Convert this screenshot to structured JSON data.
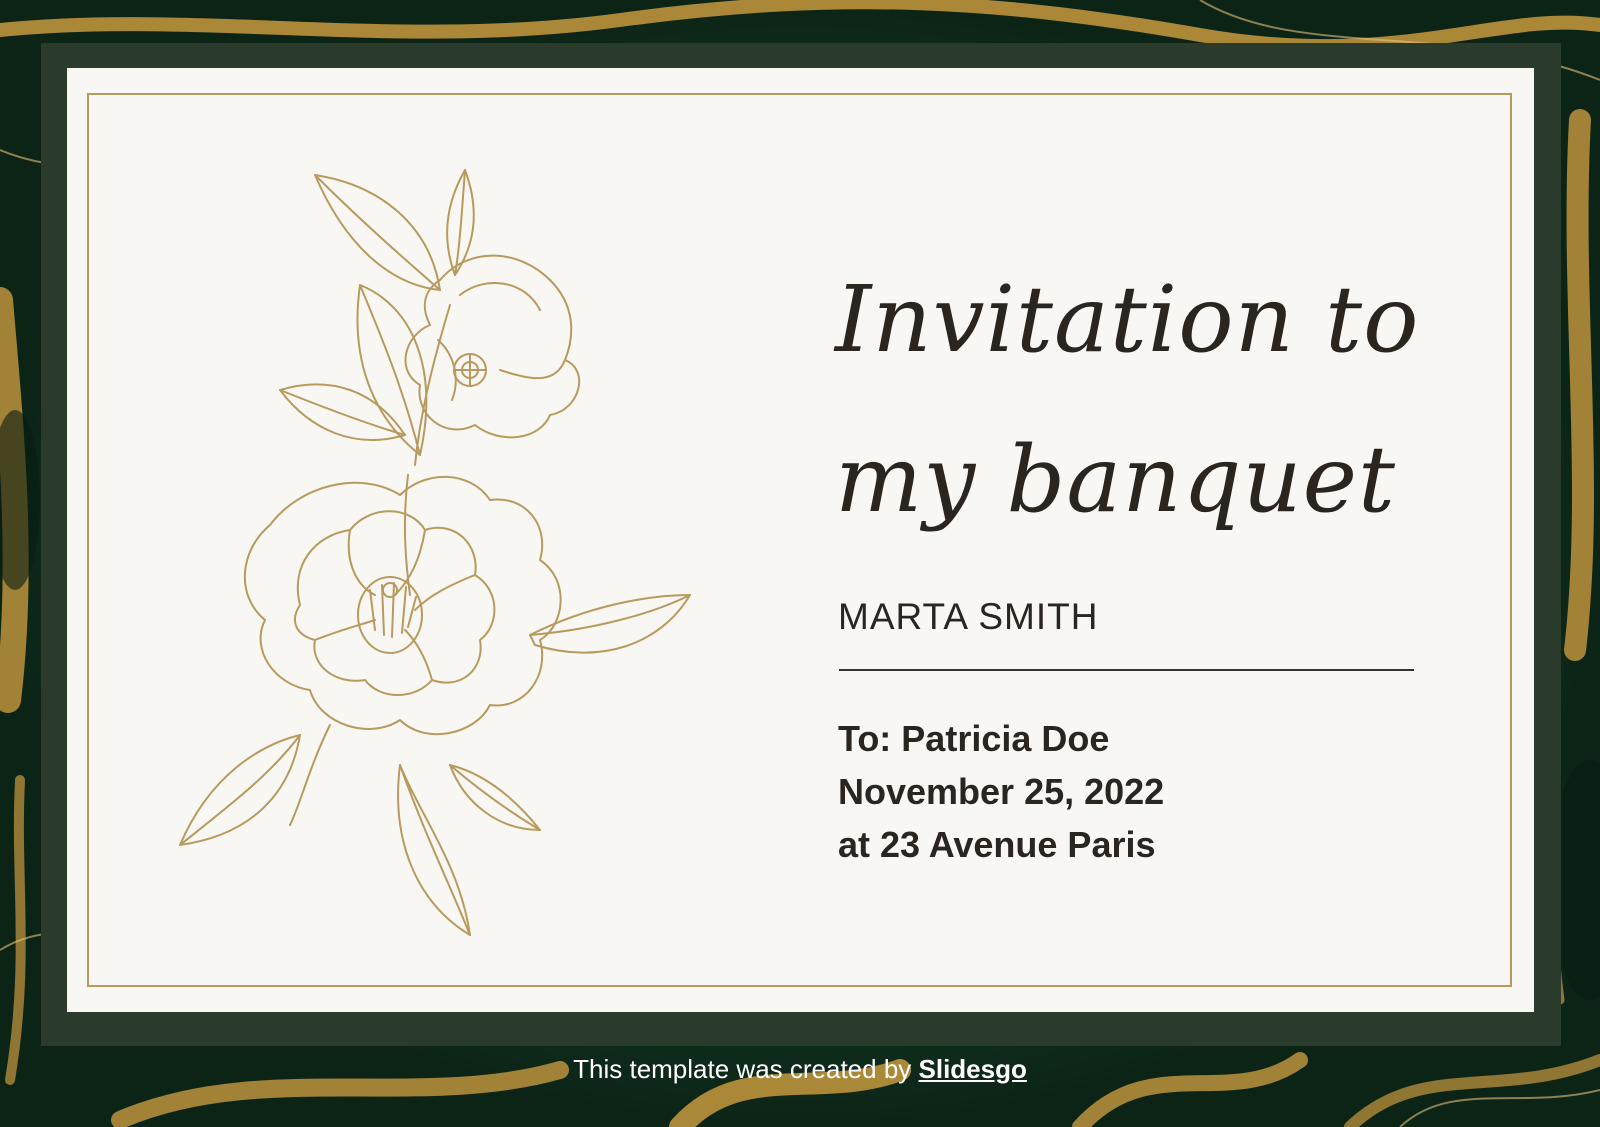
{
  "colors": {
    "frame": "#2a3a2b",
    "card": "#f9f7f3",
    "gold": "#b89a5e",
    "text": "#2b2520",
    "marble_green": "#14301f"
  },
  "invitation": {
    "title_line1": "Invitation to",
    "title_line2": "my banquet",
    "host": "MARTA SMITH",
    "recipient": "To: Patricia Doe",
    "date": "November 25, 2022",
    "location": "at 23 Avenue Paris"
  },
  "footer": {
    "credit_text": "This template was created by ",
    "credit_link": "Slidesgo"
  },
  "decorations": {
    "illustration": "camellia-floral-line-art",
    "background": "green-gold-marble"
  }
}
